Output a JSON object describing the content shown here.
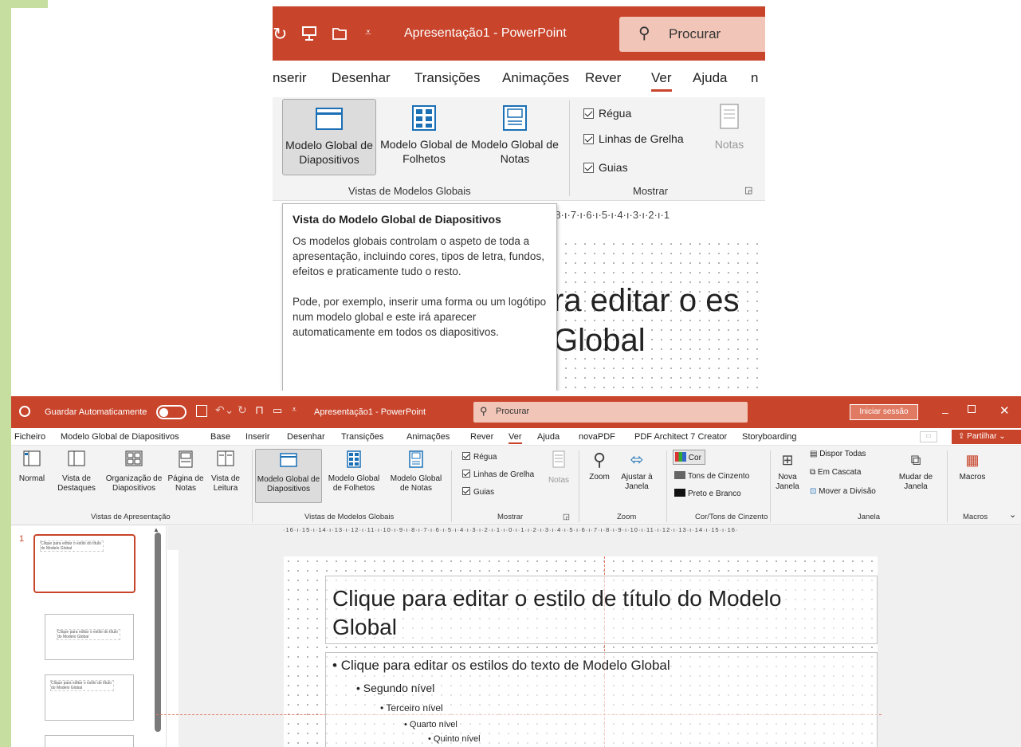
{
  "colors": {
    "brand": "#c8442b",
    "accent_green": "#c6dfa0",
    "selected_thumb": "#c8442b"
  },
  "zoom_view": {
    "title": "Apresentação1 - PowerPoint",
    "search_placeholder": "Procurar",
    "tabs": [
      "nserir",
      "Desenhar",
      "Transições",
      "Animações",
      "Rever",
      "Ver",
      "Ajuda",
      "n"
    ],
    "active_tab": "Ver",
    "buttons": {
      "master_slides": "Modelo Global de Diapositivos",
      "master_handouts": "Modelo Global de Folhetos",
      "master_notes": "Modelo Global de Notas",
      "notes": "Notas"
    },
    "checks": [
      "Régua",
      "Linhas de Grelha",
      "Guias"
    ],
    "group_master": "Vistas de Modelos Globais",
    "group_show": "Mostrar",
    "ruler_text": "·8·ı·7·ı·6·ı·5·ı·4·ı·3·ı·2·ı·1",
    "slide_text_1": "ra editar o es",
    "slide_text_2": "Global"
  },
  "tooltip": {
    "title": "Vista do Modelo Global de Diapositivos",
    "para1": "Os modelos globais controlam o aspeto de toda a apresentação, incluindo cores, tipos de letra, fundos, efeitos e praticamente tudo o resto.",
    "para2": "Pode, por exemplo, inserir uma forma ou um logótipo num modelo global e este irá aparecer automaticamente em todos os diapositivos."
  },
  "app": {
    "autosave": "Guardar Automaticamente",
    "title": "Apresentação1 - PowerPoint",
    "search_placeholder": "Procurar",
    "signin": "Iniciar sessão",
    "share": "Partilhar",
    "menu": [
      "Ficheiro",
      "Modelo Global de Diapositivos",
      "Base",
      "Inserir",
      "Desenhar",
      "Transições",
      "Animações",
      "Rever",
      "Ver",
      "Ajuda",
      "novaPDF",
      "PDF Architect 7 Creator",
      "Storyboarding"
    ],
    "ribbon": {
      "normal": "Normal",
      "outline": "Vista de Destaques",
      "sorter": "Organização de Diapositivos",
      "notes_page": "Página de Notas",
      "reading": "Vista de Leitura",
      "group_presentation": "Vistas de Apresentação",
      "master_slides": "Modelo Global de Diapositivos",
      "master_handouts": "Modelo Global de Folhetos",
      "master_notes": "Modelo Global de Notas",
      "group_master": "Vistas de Modelos Globais",
      "ruler": "Régua",
      "gridlines": "Linhas de Grelha",
      "guides": "Guias",
      "notes": "Notas",
      "group_show": "Mostrar",
      "zoom": "Zoom",
      "fit": "Ajustar à Janela",
      "group_zoom": "Zoom",
      "color": "Cor",
      "grayscale": "Tons de Cinzento",
      "bw": "Preto e Branco",
      "group_color": "Cor/Tons de Cinzento",
      "new_window": "Nova Janela",
      "arrange_all": "Dispor Todas",
      "cascade": "Em Cascata",
      "move_split": "Mover a Divisão",
      "switch_windows": "Mudar de Janela",
      "group_window": "Janela",
      "macros": "Macros",
      "group_macros": "Macros"
    },
    "ruler_text": "·16·ı·15·ı·14·ı·13·ı·12·ı·11·ı·10·ı·9·ı·8·ı·7·ı·6·ı·5·ı·4·ı·3·ı·2·ı·1·ı·0·ı·1·ı·2·ı·3·ı·4·ı·5·ı·6·ı·7·ı·8·ı·9·ı·10·ı·11·ı·12·ı·13·ı·14·ı·15·ı·16·",
    "slide_number": "1",
    "slide": {
      "title": "Clique para editar o estilo de título do Modelo Global",
      "level1": "Clique para editar os estilos do texto de Modelo Global",
      "level2": "Segundo nível",
      "level3": "Terceiro nível",
      "level4": "Quarto nível",
      "level5": "Quinto nível"
    },
    "thumbs": {
      "t1": "Clique para editar o estilo do título do Modelo Global",
      "t2": "Clique para editar o estilo do título do Modelo Global",
      "t3": "Clique para editar o estilo do título do Modelo Global"
    }
  }
}
